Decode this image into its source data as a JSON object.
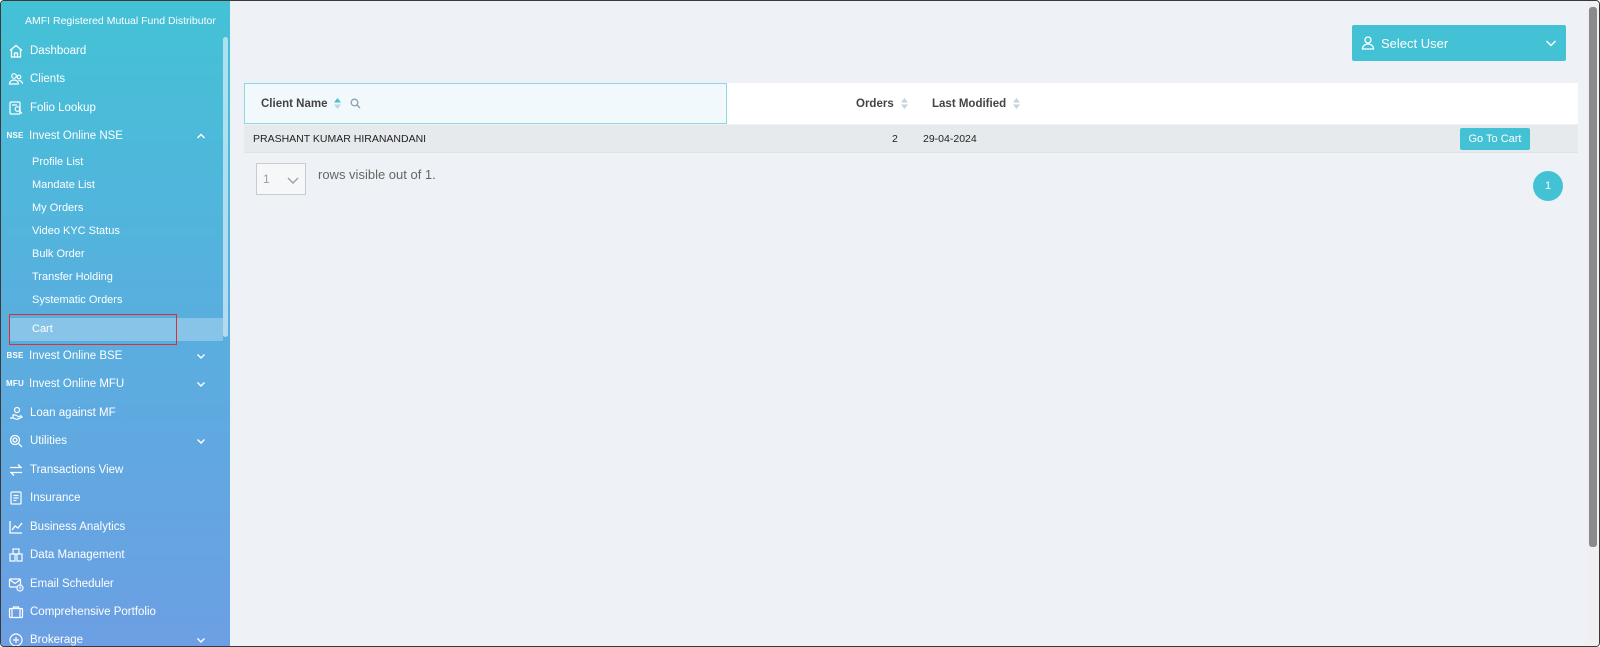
{
  "sidebar": {
    "brand": "AMFI Registered Mutual Fund Distributor",
    "items": [
      {
        "label": "Dashboard",
        "icon": "home-icon"
      },
      {
        "label": "Clients",
        "icon": "clients-icon"
      },
      {
        "label": "Folio Lookup",
        "icon": "folio-lookup-icon"
      },
      {
        "label": "Invest Online NSE",
        "tag": "NSE",
        "expanded": true
      },
      {
        "label": "Invest Online BSE",
        "tag": "BSE"
      },
      {
        "label": "Invest Online MFU",
        "tag": "MFU"
      },
      {
        "label": "Loan against MF",
        "icon": "loan-icon"
      },
      {
        "label": "Utilities",
        "icon": "utilities-icon"
      },
      {
        "label": "Transactions View",
        "icon": "transfer-arrows-icon"
      },
      {
        "label": "Insurance",
        "icon": "insurance-icon"
      },
      {
        "label": "Business Analytics",
        "icon": "analytics-chart-icon"
      },
      {
        "label": "Data Management",
        "icon": "data-management-icon"
      },
      {
        "label": "Email Scheduler",
        "icon": "email-scheduler-icon"
      },
      {
        "label": "Comprehensive Portfolio",
        "icon": "portfolio-briefcase-icon"
      },
      {
        "label": "Brokerage",
        "icon": "brokerage-icon"
      }
    ],
    "nse_subitems": [
      "Profile List",
      "Mandate List",
      "My Orders",
      "Video KYC Status",
      "Bulk Order",
      "Transfer Holding",
      "Systematic Orders",
      "Cart"
    ],
    "active_subitem": "Cart"
  },
  "header": {
    "select_user_label": "Select User"
  },
  "table": {
    "columns": [
      "Client Name",
      "Orders",
      "Last Modified"
    ],
    "rows": [
      {
        "client_name": "PRASHANT KUMAR HIRANANDANI",
        "orders": "2",
        "last_modified": "29-04-2024",
        "action": "Go To Cart"
      }
    ]
  },
  "pagination": {
    "rows_per_page": "1",
    "rows_text": "rows visible out of 1.",
    "current_page": "1"
  },
  "colors": {
    "accent": "#43c2d6",
    "sidebar_top": "#43c2d6",
    "sidebar_bottom": "#6c9fe3",
    "highlight": "#d93030"
  }
}
